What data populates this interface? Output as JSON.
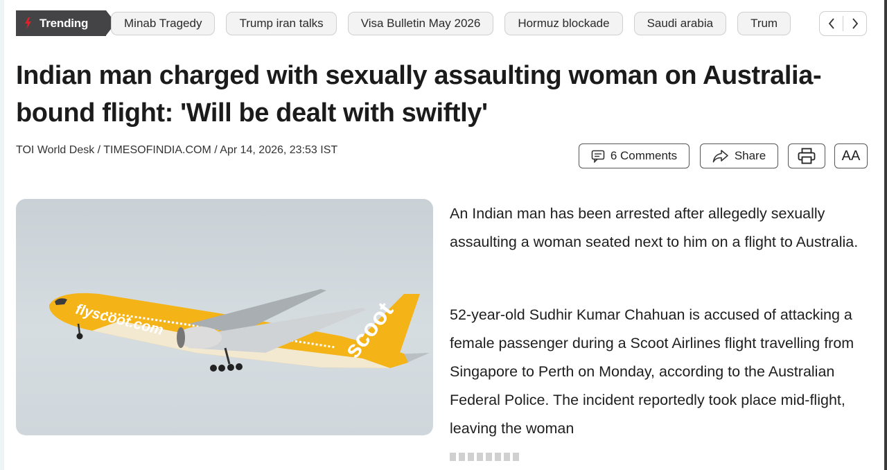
{
  "trending": {
    "label": "Trending",
    "chips": [
      "Minab Tragedy",
      "Trump iran talks",
      "Visa Bulletin May 2026",
      "Hormuz blockade",
      "Saudi arabia",
      "Trum"
    ],
    "accent_color": "#e0202a"
  },
  "article": {
    "headline": "Indian man charged with sexually assaulting woman on Australia-bound flight: 'Will be dealt with swiftly'",
    "byline": "TOI World Desk / TIMESOFINDIA.COM / Apr 14, 2026, 23:53 IST",
    "actions": {
      "comments": "6 Comments",
      "share": "Share",
      "font_size": "AA"
    },
    "image_alt_text": "flyscoot.com scoot",
    "paragraphs": [
      "An Indian man has been arrested after allegedly sexually assaulting a woman seated next to him on a flight to Australia.",
      "52-year-old Sudhir Kumar Chahuan is accused of attacking a female passenger during a Scoot Airlines flight travelling from Singapore to Perth on Monday, according to the Australian Federal Police. The incident reportedly took place mid-flight, leaving the woman"
    ]
  },
  "colors": {
    "plane_yellow": "#f4b316",
    "trending_bg": "#444446"
  }
}
